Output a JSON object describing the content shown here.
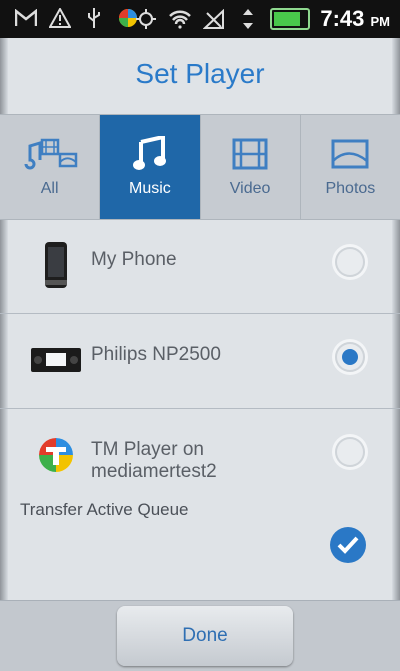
{
  "status_bar": {
    "time": "7:43",
    "ampm": "PM",
    "icons": [
      "gmail-icon",
      "warning-icon",
      "usb-icon",
      "app-icon",
      "gps-icon",
      "wifi-icon",
      "signal-off-icon",
      "data-arrows-icon",
      "battery-icon"
    ]
  },
  "dialog": {
    "title": "Set Player"
  },
  "tabs": [
    {
      "label": "All",
      "icon": "all-media-icon",
      "active": false
    },
    {
      "label": "Music",
      "icon": "music-note-icon",
      "active": true
    },
    {
      "label": "Video",
      "icon": "film-icon",
      "active": false
    },
    {
      "label": "Photos",
      "icon": "photo-icon",
      "active": false
    }
  ],
  "players": [
    {
      "label": "My Phone",
      "icon": "phone-icon",
      "selected": false
    },
    {
      "label": "Philips NP2500",
      "icon": "stereo-icon",
      "selected": true
    },
    {
      "label": "TM Player on mediamertest2",
      "icon": "tm-player-icon",
      "selected": false
    }
  ],
  "transfer": {
    "label": "Transfer Active Queue",
    "checked": true
  },
  "footer": {
    "done_label": "Done"
  },
  "colors": {
    "accent": "#2a78c6",
    "active_tab": "#1f67a8"
  }
}
